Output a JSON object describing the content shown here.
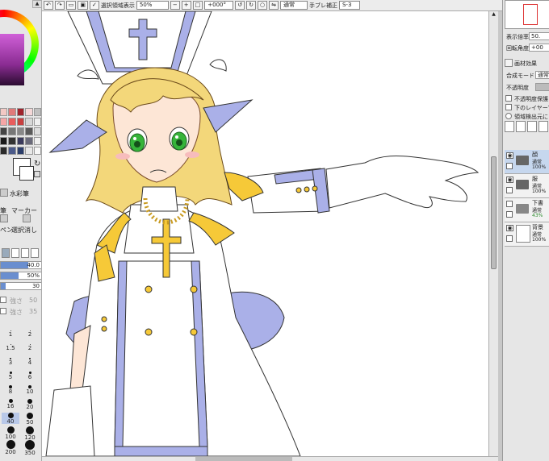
{
  "toolbar": {
    "show_selection_label": "選択領域表示",
    "zoom_value": "50%",
    "rotation_value": "+000°",
    "blend_mode_value": "通常",
    "stabilizer_label": "手ブレ補正",
    "stabilizer_value": "S-3"
  },
  "left_panel": {
    "tools": {
      "watercolor": "水彩筆",
      "brush_partial": "筆",
      "marker": "マーカー",
      "pen_partial": "ペン",
      "selection_eraser": "選択消し"
    },
    "brush_size_value": "40.0",
    "brush_density_value": "50%",
    "third_value": "30",
    "dim_row1_label": "強さ",
    "dim_row1_value": "50",
    "dim_row2_label": "強さ",
    "dim_row2_value": "35",
    "size_labels": [
      "1",
      "2",
      "1.5",
      "2",
      "3",
      "4",
      "5",
      "6",
      "8",
      "10",
      "16",
      "20",
      "40",
      "50",
      "100",
      "120",
      "200",
      "350"
    ],
    "swatch_colors": [
      [
        "#f2c9c4",
        "#e07a7a",
        "#a0232b",
        "#f5d8d8",
        "#bfbfbf"
      ],
      [
        "#f5a6a6",
        "#e85d5d",
        "#c84040",
        "#d8d8d8",
        "#efefef"
      ],
      [
        "#444444",
        "#777777",
        "#888888",
        "#5a5a5a",
        "#dddddd"
      ],
      [
        "#1a1a1a",
        "#333333",
        "#3a3a5c",
        "#6a6a7a",
        "#f0f0f0"
      ],
      [
        "#2a2a2a",
        "#4b5a8a",
        "#2c3e6b",
        "#e8e8e8",
        "#f7f7f7"
      ]
    ]
  },
  "right_panel": {
    "display_scale_label": "表示倍率",
    "display_scale_value": "50.",
    "rotation_label": "回転角度",
    "rotation_value": "+00",
    "paper_effect_label": "画材効果",
    "blend_mode_label": "合成モード",
    "blend_mode_value": "通常",
    "opacity_label": "不透明度",
    "preserve_opacity_label": "不透明度保護",
    "clip_lower_label": "下のレイヤーで",
    "region_detect_label": "領域検出元に",
    "layers": [
      {
        "name": "顔",
        "mode": "通常",
        "opacity": "100%",
        "type": "folder"
      },
      {
        "name": "服",
        "mode": "通常",
        "opacity": "100%",
        "type": "folder"
      },
      {
        "name": "下書",
        "mode": "通常",
        "opacity": "43%",
        "type": "folder"
      },
      {
        "name": "背景",
        "mode": "通常",
        "opacity": "100%",
        "type": "image"
      }
    ]
  }
}
